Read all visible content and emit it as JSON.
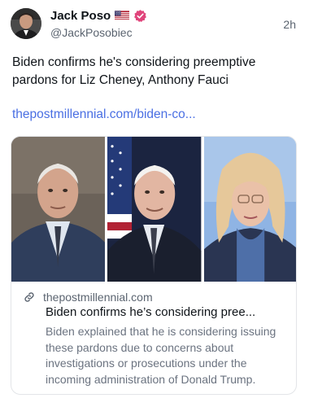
{
  "author": {
    "display_name": "Jack Poso",
    "handle": "@JackPosobiec",
    "flag_icon": "us-flag-icon",
    "badge_icon": "verified-badge-icon",
    "badge_color": "#e0457b"
  },
  "post": {
    "time": "2h",
    "text": "Biden confirms he's considering preemptive pardons for Liz Cheney, Anthony Fauci",
    "link_text": "thepostmillennial.com/biden-co...",
    "link_color": "#4a6fe3"
  },
  "card": {
    "domain": "thepostmillennial.com",
    "title": "Biden confirms he’s considering pree...",
    "description": "Biden explained that he is considering issuing these pardons due to concerns about investigations or prosecutions under the incoming administration of Donald Trump.",
    "icon": "link-icon"
  }
}
